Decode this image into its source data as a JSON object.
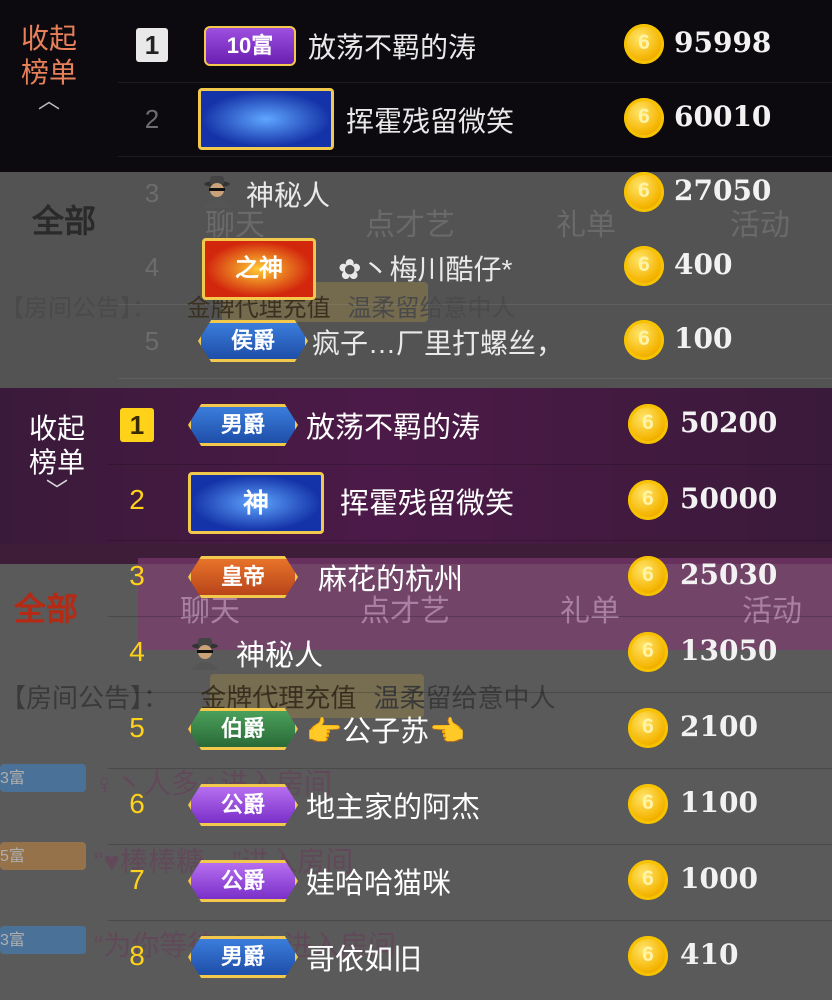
{
  "top_panel": {
    "collapse": {
      "label": "收起榜单",
      "chevron": "chevron-up-icon"
    },
    "ghost_tabs": {
      "all": "全部",
      "tabs": [
        "聊天",
        "点才艺",
        "礼单",
        "活动"
      ]
    },
    "ghost_notice": {
      "label": "【房间公告】：",
      "tag": "金牌代理充值",
      "text": "温柔留给意中人"
    },
    "rows": [
      {
        "rank": "1",
        "badge": "10富",
        "badge_type": "wealth",
        "name": "放荡不羁的涛",
        "score": "95998"
      },
      {
        "rank": "2",
        "badge": "",
        "badge_type": "god",
        "name": "挥霍残留微笑",
        "score": "60010"
      },
      {
        "rank": "3",
        "badge": "",
        "badge_type": "spy",
        "name": "神秘人",
        "score": "27050"
      },
      {
        "rank": "4",
        "badge": "之神",
        "badge_type": "god2",
        "name": "✿丶梅川酷仔*",
        "score": "400"
      },
      {
        "rank": "5",
        "badge": "侯爵",
        "badge_type": "noble-blue",
        "name": "疯子…厂里打螺丝，",
        "score": "100"
      }
    ]
  },
  "bottom_panel": {
    "collapse": {
      "label": "收起榜单",
      "chevron": "chevron-down-icon"
    },
    "ghost_tabs": {
      "all": "全部",
      "tabs": [
        "聊天",
        "点才艺",
        "礼单",
        "活动"
      ]
    },
    "ghost_notice": {
      "label": "【房间公告】：",
      "tag": "金牌代理充值",
      "text": "温柔留给意中人"
    },
    "ghost_chat": [
      {
        "badge": "3富",
        "text": "♀丶人多♀进入房间"
      },
      {
        "badge": "5富",
        "text": "“♥棒棒糖、、”进入房间"
      },
      {
        "badge": "3富",
        "text": "“为你等待wh✿”进入房间"
      }
    ],
    "rows": [
      {
        "rank": "1",
        "badge": "男爵",
        "badge_type": "noble-blue",
        "name": "放荡不羁的涛",
        "score": "50200"
      },
      {
        "rank": "2",
        "badge": "神",
        "badge_type": "god",
        "name": "挥霍残留微笑",
        "score": "50000"
      },
      {
        "rank": "3",
        "badge": "皇帝",
        "badge_type": "noble-emperor",
        "name": "麻花的杭州",
        "score": "25030"
      },
      {
        "rank": "4",
        "badge": "",
        "badge_type": "spy",
        "name": "神秘人",
        "score": "13050"
      },
      {
        "rank": "5",
        "badge": "伯爵",
        "badge_type": "noble-green",
        "name": "👉公子苏👈",
        "score": "2100"
      },
      {
        "rank": "6",
        "badge": "公爵",
        "badge_type": "noble-purple",
        "name": "地主家的阿杰",
        "score": "1100"
      },
      {
        "rank": "7",
        "badge": "公爵",
        "badge_type": "noble-purple",
        "name": "娃哈哈猫咪",
        "score": "1000"
      },
      {
        "rank": "8",
        "badge": "男爵",
        "badge_type": "noble-blue",
        "name": "哥依如旧",
        "score": "410"
      }
    ]
  },
  "colors": {
    "gold": "#ffd21a",
    "coin": "#f5b400",
    "collapse_top": "#e8805a"
  }
}
